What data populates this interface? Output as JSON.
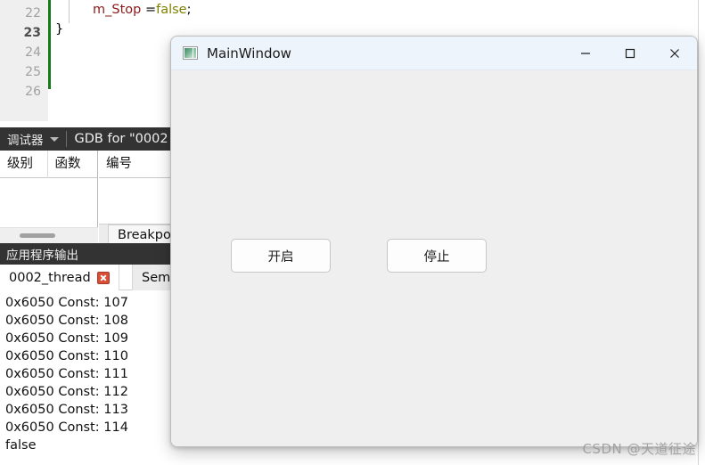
{
  "editor": {
    "gutter_lines": [
      "22",
      "23",
      "24",
      "25",
      "26"
    ],
    "current_line": "23",
    "code_lines": [
      {
        "tokens": [
          {
            "t": "m_Stop ",
            "c": "tok-var"
          },
          {
            "t": "=",
            "c": "tok-op"
          },
          {
            "t": "false",
            "c": "tok-kw"
          },
          {
            "t": ";",
            "c": "tok-punc"
          }
        ]
      },
      {
        "tokens": [
          {
            "t": "}",
            "c": "tok-brace"
          }
        ]
      }
    ]
  },
  "debugger_bar": {
    "label": "调试器",
    "caret": "chevron-down-icon",
    "title": "GDB for \"0002"
  },
  "panes": {
    "left_headers": [
      "级别",
      "函数"
    ],
    "right_headers": [
      "编号"
    ],
    "breakpoints_tab": "Breakpoin"
  },
  "output_panel": {
    "header": "应用程序输出",
    "tabs": [
      {
        "label": "0002_thread",
        "active": true,
        "closable": true
      },
      {
        "label": "Sem",
        "active": false,
        "closable": false
      }
    ],
    "lines": [
      "0x6050 Const: 107",
      "0x6050 Const: 108",
      "0x6050 Const: 109",
      "0x6050 Const: 110",
      "0x6050 Const: 111",
      "0x6050 Const: 112",
      "0x6050 Const: 113",
      "0x6050 Const: 114",
      "false"
    ]
  },
  "dialog": {
    "title": "MainWindow",
    "icon": "qt-window-icon",
    "controls": {
      "minimize": "minimize-icon",
      "maximize": "maximize-icon",
      "close": "close-icon"
    },
    "buttons": {
      "start": "开启",
      "stop": "停止"
    }
  },
  "watermark": {
    "text": "CSDN @天道征途"
  },
  "colors": {
    "dark_bar": "#333333",
    "dialog_body": "#efefef",
    "titlebar": "#eef4fb",
    "green_marker": "#1a7a1a",
    "close_tab_red": "#d94f36",
    "keyword": "#808000",
    "variable": "#8b1a1a"
  }
}
